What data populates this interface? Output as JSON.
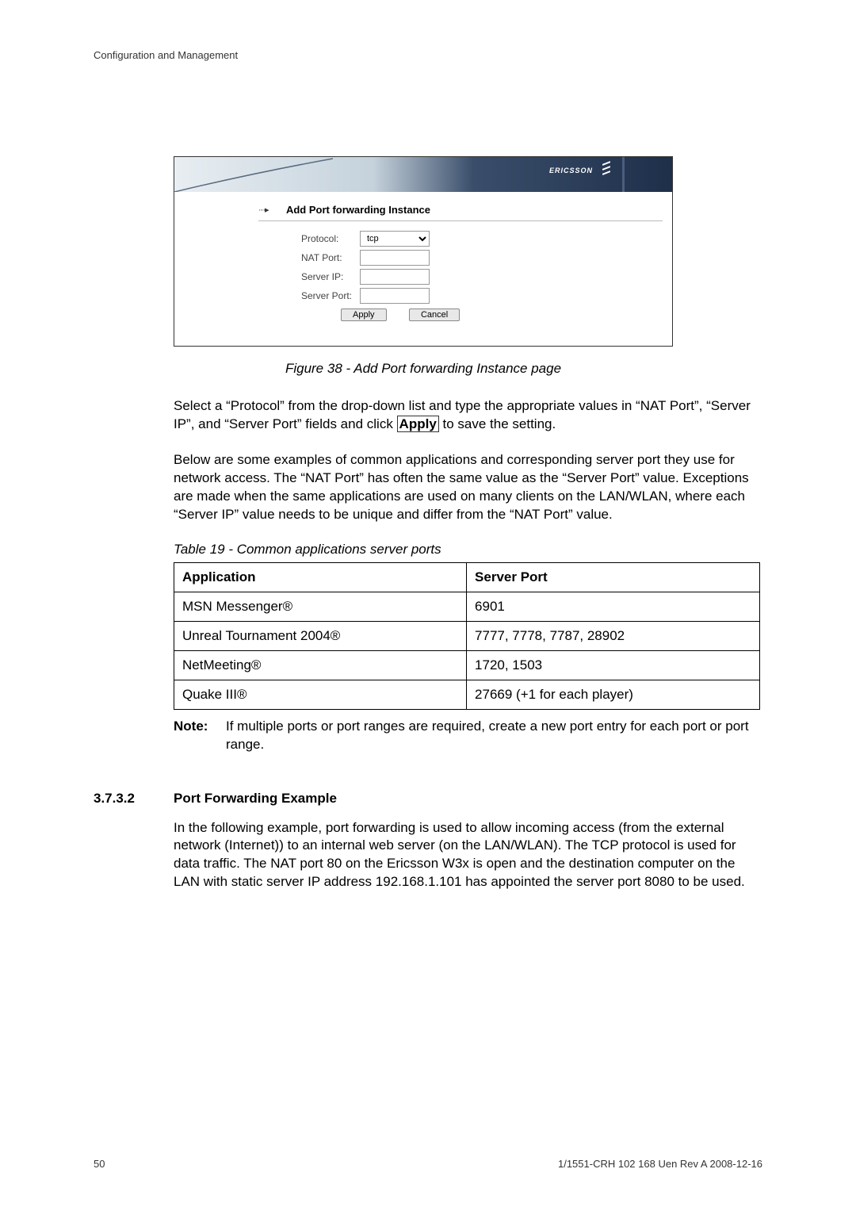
{
  "header": "Configuration and Management",
  "screenshot": {
    "logo_text": "ERICSSON",
    "title": "Add Port forwarding Instance",
    "labels": {
      "protocol": "Protocol:",
      "nat_port": "NAT Port:",
      "server_ip": "Server IP:",
      "server_port": "Server Port:"
    },
    "protocol_value": "tcp",
    "buttons": {
      "apply": "Apply",
      "cancel": "Cancel"
    }
  },
  "figure_caption": "Figure 38 - Add Port forwarding Instance page",
  "para1_a": "Select a “Protocol” from the drop-down list and type the appropriate values in “NAT Port”, “Server IP”, and “Server Port” fields and click ",
  "apply_bold": "Apply",
  "para1_b": " to save the setting.",
  "para2": "Below are some examples of common applications and corresponding server port they use for network access. The “NAT Port” has often the same value as the “Server Port” value. Exceptions are made when the same applications are used on many clients on the LAN/WLAN, where each “Server IP” value needs to be unique and differ from the “NAT Port” value.",
  "table_caption": "Table 19 - Common applications server ports",
  "table": {
    "headers": {
      "app": "Application",
      "port": "Server Port"
    },
    "rows": [
      {
        "app": "MSN Messenger®",
        "port": "6901"
      },
      {
        "app": "Unreal Tournament 2004®",
        "port": "7777, 7778, 7787, 28902"
      },
      {
        "app": "NetMeeting®",
        "port": "1720, 1503"
      },
      {
        "app": "Quake III®",
        "port": "27669 (+1 for each player)"
      }
    ]
  },
  "note": {
    "label": "Note:",
    "text": "If multiple ports or port ranges are required, create a new port entry for each port or port range."
  },
  "section": {
    "num": "3.7.3.2",
    "title": "Port Forwarding Example"
  },
  "para3": "In the following example, port forwarding is used to allow incoming access (from the external network (Internet)) to an internal web server (on the LAN/WLAN). The TCP protocol is used for data traffic. The NAT port 80 on the Ericsson W3x is open and the destination computer on the LAN with static server IP address 192.168.1.101 has appointed the server port 8080 to be used.",
  "footer": {
    "page": "50",
    "ref": "1/1551-CRH 102 168 Uen Rev A  2008-12-16"
  }
}
